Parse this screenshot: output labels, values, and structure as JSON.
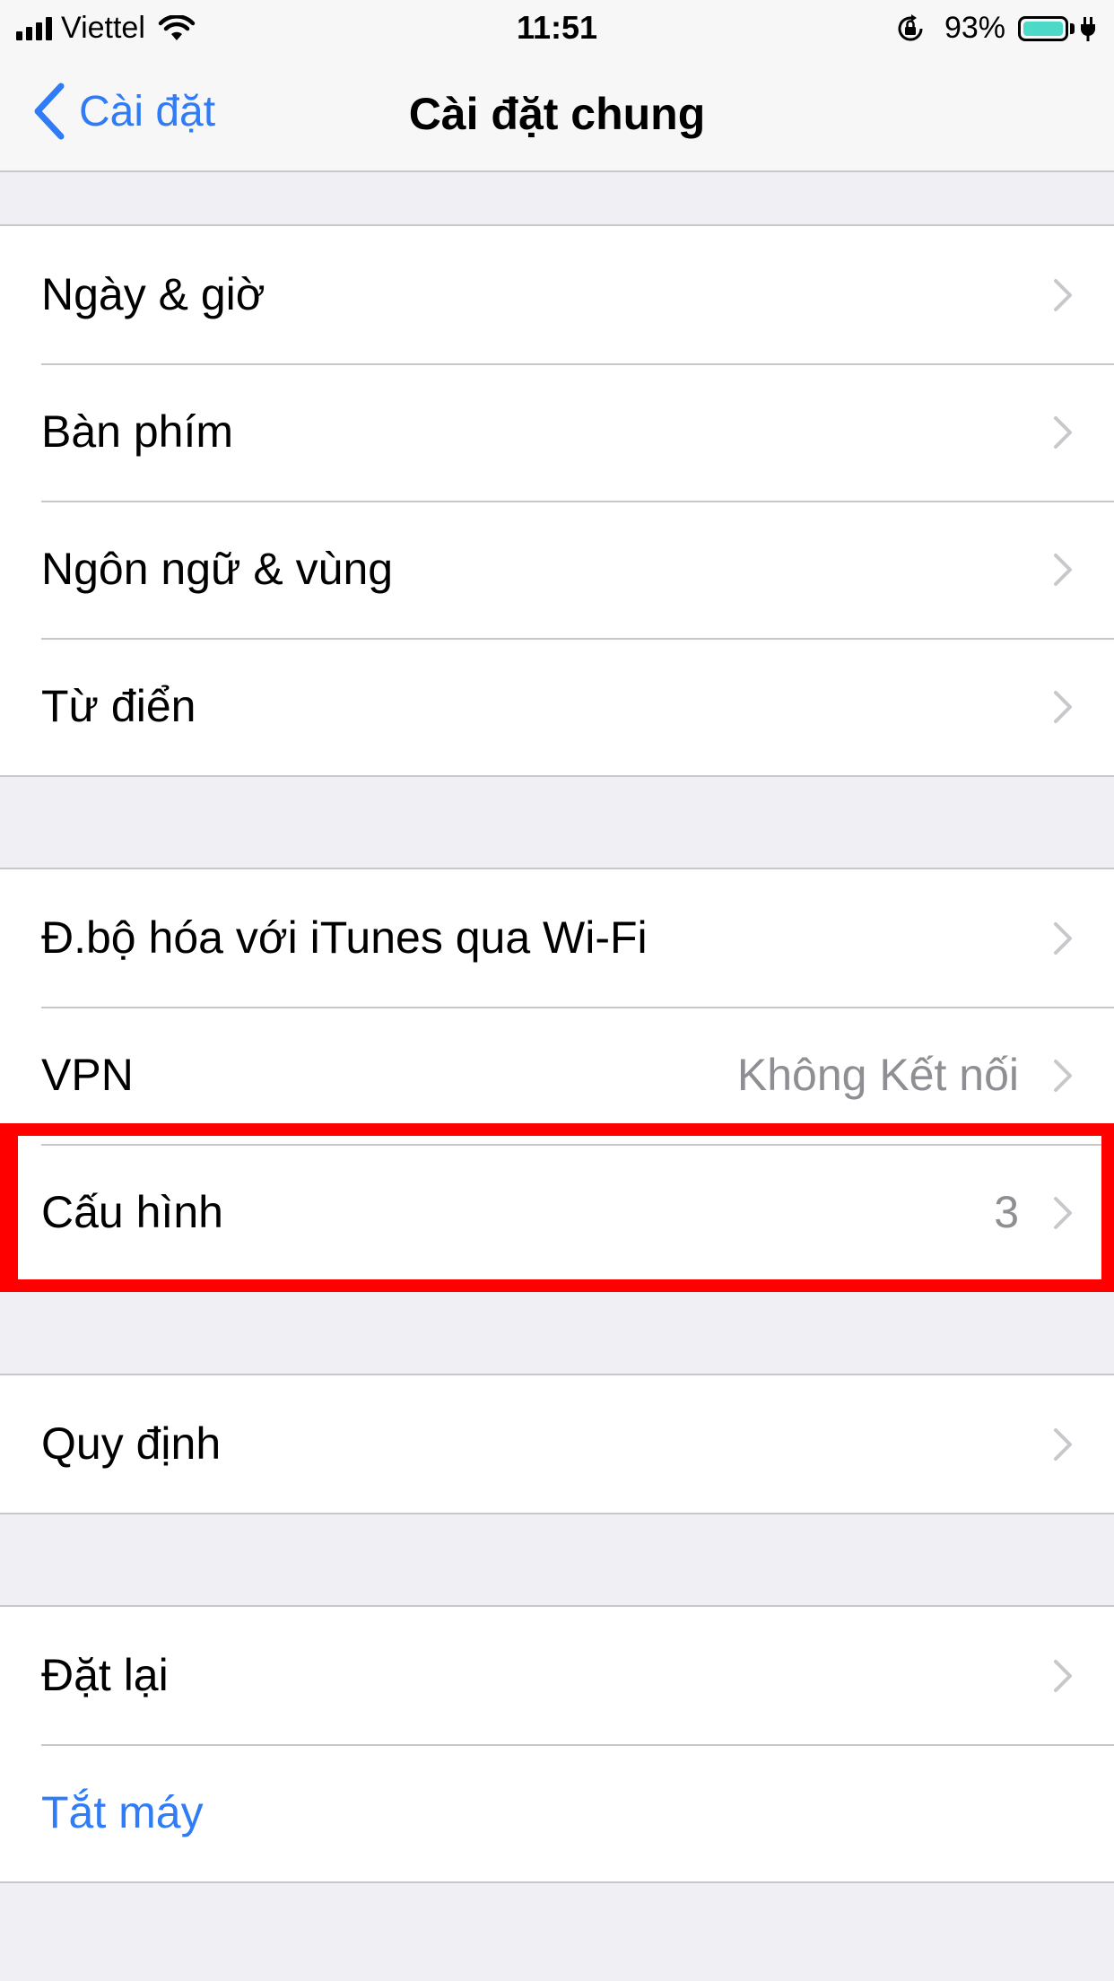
{
  "status_bar": {
    "carrier": "Viettel",
    "time": "11:51",
    "battery_percent": "93%",
    "battery_color": "#4cd9c8",
    "icons": [
      "signal-icon",
      "wifi-icon",
      "rotation-lock-icon",
      "battery-icon",
      "charging-icon"
    ]
  },
  "nav": {
    "back_label": "Cài đặt",
    "title": "Cài đặt chung"
  },
  "groups": [
    {
      "rows": [
        {
          "label": "Ngày & giờ"
        },
        {
          "label": "Bàn phím"
        },
        {
          "label": "Ngôn ngữ & vùng"
        },
        {
          "label": "Từ điển"
        }
      ]
    },
    {
      "rows": [
        {
          "label": "Đ.bộ hóa với iTunes qua Wi-Fi"
        },
        {
          "label": "VPN",
          "value": "Không Kết nối"
        },
        {
          "label": "Cấu hình",
          "value": "3",
          "highlighted": true
        }
      ]
    },
    {
      "rows": [
        {
          "label": "Quy định"
        }
      ]
    },
    {
      "rows": [
        {
          "label": "Đặt lại"
        },
        {
          "label": "Tắt máy"
        }
      ]
    }
  ],
  "colors": {
    "accent": "#2f7cf6",
    "highlight": "#ff0000",
    "background": "#efeff4"
  }
}
